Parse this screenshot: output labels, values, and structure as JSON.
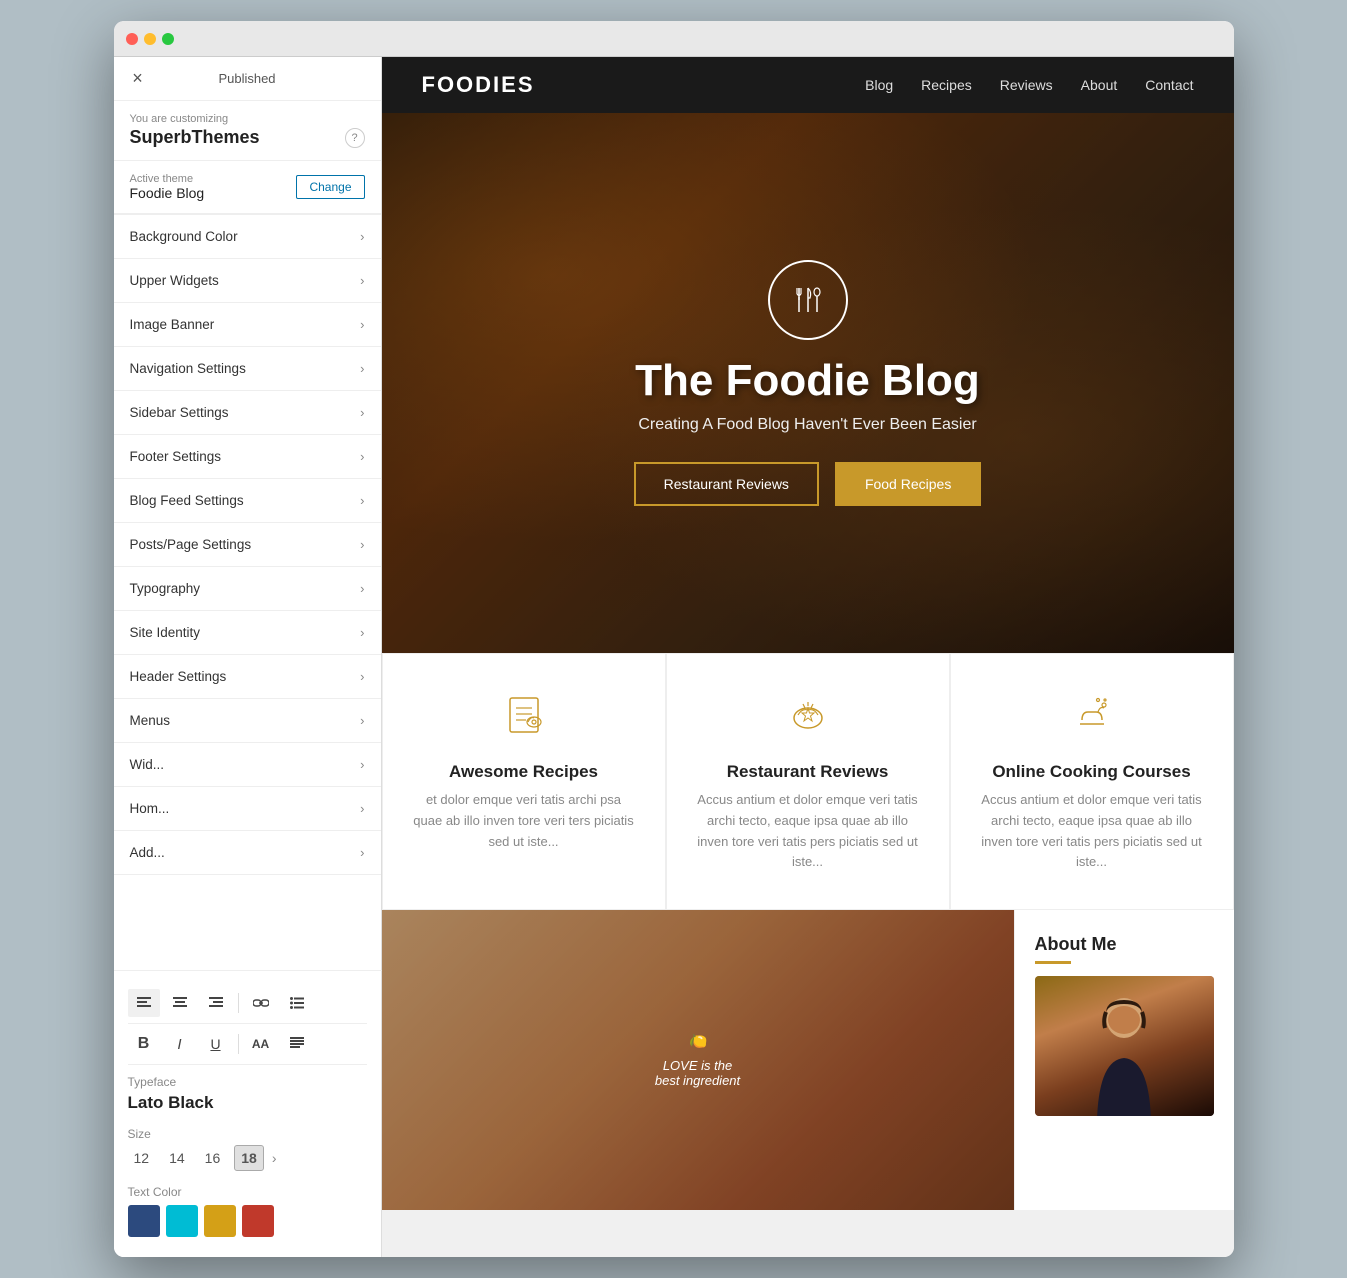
{
  "browser": {
    "dot_colors": [
      "#ff5f57",
      "#ffbd2e",
      "#28c840"
    ]
  },
  "panel": {
    "close_label": "×",
    "published_label": "Published",
    "customizing_label": "You are customizing",
    "customizing_name": "SuperbThemes",
    "active_theme_label": "Active theme",
    "active_theme_name": "Foodie Blog",
    "change_btn_label": "Change",
    "help_icon": "?",
    "menu_items": [
      {
        "label": "Background Color",
        "id": "background-color"
      },
      {
        "label": "Upper Widgets",
        "id": "upper-widgets"
      },
      {
        "label": "Image Banner",
        "id": "image-banner"
      },
      {
        "label": "Navigation Settings",
        "id": "navigation-settings"
      },
      {
        "label": "Sidebar Settings",
        "id": "sidebar-settings"
      },
      {
        "label": "Footer Settings",
        "id": "footer-settings"
      },
      {
        "label": "Blog Feed Settings",
        "id": "blog-feed-settings"
      },
      {
        "label": "Posts/Page Settings",
        "id": "posts-page-settings"
      },
      {
        "label": "Typography",
        "id": "typography"
      },
      {
        "label": "Site Identity",
        "id": "site-identity"
      },
      {
        "label": "Header Settings",
        "id": "header-settings"
      },
      {
        "label": "Menus",
        "id": "menus"
      },
      {
        "label": "Wid...",
        "id": "widgets"
      },
      {
        "label": "Hom...",
        "id": "homepage-settings"
      },
      {
        "label": "Add...",
        "id": "additional-css"
      }
    ]
  },
  "typography_panel": {
    "toolbar": {
      "align_left": "≡",
      "align_center": "≡",
      "align_right": "≡",
      "link": "🔗",
      "list": "≡",
      "bold": "B",
      "italic": "I",
      "underline": "U",
      "aa_label": "AA",
      "paragraph": "¶"
    },
    "typeface_label": "Typeface",
    "typeface_value": "Lato Black",
    "size_label": "Size",
    "sizes": [
      "12",
      "14",
      "16",
      "18"
    ],
    "active_size": "18",
    "text_color_label": "Text Color",
    "color_swatches": [
      "#2c4a7e",
      "#00bcd4",
      "#d4a017",
      "#c0392b"
    ]
  },
  "site": {
    "logo": "FOODIES",
    "nav_items": [
      "Blog",
      "Recipes",
      "Reviews",
      "About",
      "Contact"
    ],
    "hero": {
      "title": "The Foodie Blog",
      "subtitle": "Creating A Food Blog Haven't Ever Been Easier",
      "btn1": "Restaurant Reviews",
      "btn2": "Food Recipes"
    },
    "features": [
      {
        "icon": "📋",
        "title": "Awesome Recipes",
        "text": "et dolor emque veri tatis archi psa quae ab illo inven tore veri ters piciatis sed ut iste..."
      },
      {
        "icon": "⭐",
        "title": "Restaurant Reviews",
        "text": "Accus antium et dolor emque veri tatis archi tecto, eaque ipsa quae ab illo inven tore veri tatis pers piciatis sed ut iste..."
      },
      {
        "icon": "🍳",
        "title": "Online Cooking Courses",
        "text": "Accus antium et dolor emque veri tatis archi tecto, eaque ipsa quae ab illo inven tore veri tatis pers piciatis sed ut iste..."
      }
    ],
    "about_me": {
      "title": "About Me",
      "text": "LOVE is the best ingredient"
    }
  }
}
